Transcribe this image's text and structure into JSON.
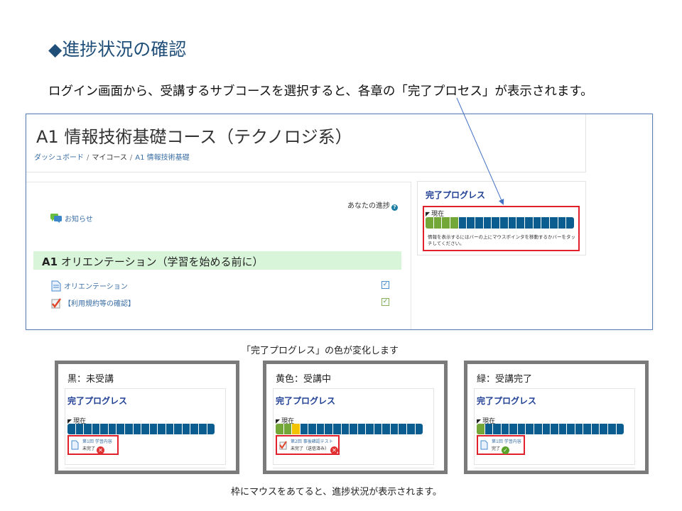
{
  "slide": {
    "title": "◆進捗状況の確認",
    "intro": "ログイン画面から、受講するサブコースを選択すると、各章の「完了プロセス」が表示されます。",
    "color_caption": "「完了プログレス」の色が変化します",
    "footer_caption": "枠にマウスをあてると、進捗状況が表示されます。"
  },
  "course": {
    "title": "A1 情報技術基礎コース（テクノロジ系）",
    "breadcrumb": [
      "ダッシュボード",
      "マイコース",
      "A1 情報技術基礎"
    ],
    "your_progress": "あなたの進捗",
    "announcement": "お知らせ",
    "section": {
      "prefix": "A1",
      "title": " オリエンテーション（学習を始める前に）"
    },
    "activities": [
      {
        "label": "オリエンテーション",
        "icon": "page-icon",
        "checked": true
      },
      {
        "label": "【利用規約等の確認】",
        "icon": "assignment-icon",
        "checked": true
      }
    ]
  },
  "progress_block": {
    "title": "完了プログレス",
    "now_label": "現在",
    "help": "情報を表示するにはバーの上にマウスポインタを移動するかバーをタッチしてください。",
    "cells": [
      "green",
      "green",
      "green",
      "green",
      "blue",
      "blue",
      "blue",
      "blue",
      "blue",
      "blue",
      "blue",
      "blue",
      "blue",
      "blue",
      "blue",
      "blue",
      "blue",
      "blue"
    ]
  },
  "states": [
    {
      "label": "黒：未受講",
      "block_title": "完了プログレス",
      "now_label": "現在",
      "cells": [
        "blue",
        "blue",
        "blue",
        "blue",
        "blue",
        "blue",
        "blue",
        "blue",
        "blue",
        "blue",
        "blue",
        "blue",
        "blue",
        "blue",
        "blue",
        "blue",
        "blue",
        "blue"
      ],
      "tip_title": "第1回 学習内容",
      "tip_status": "未完了",
      "status_icon": "cross-icon",
      "status_color": "#e03131"
    },
    {
      "label": "黄色：受講中",
      "block_title": "完了プログレス",
      "now_label": "現在",
      "cells": [
        "green",
        "green",
        "yellow",
        "blue",
        "blue",
        "blue",
        "blue",
        "blue",
        "blue",
        "blue",
        "blue",
        "blue",
        "blue",
        "blue",
        "blue",
        "blue",
        "blue",
        "blue"
      ],
      "tip_title": "第2回 事後確認テスト",
      "tip_status": "未完了（送信済み）",
      "status_icon": "cross-icon",
      "status_color": "#e03131"
    },
    {
      "label": "緑：受講完了",
      "block_title": "完了プログレス",
      "now_label": "現在",
      "cells": [
        "green",
        "blue",
        "blue",
        "blue",
        "blue",
        "blue",
        "blue",
        "blue",
        "blue",
        "blue",
        "blue",
        "blue",
        "blue",
        "blue",
        "blue",
        "blue",
        "blue",
        "blue"
      ],
      "tip_title": "第1回 学習内容",
      "tip_status": "完了",
      "status_icon": "check-icon",
      "status_color": "#5aa32a"
    }
  ],
  "colors": {
    "complete": "#73a839",
    "incomplete": "#0b5d8f",
    "in_progress": "#f2c300",
    "highlight": "#e0202a"
  }
}
